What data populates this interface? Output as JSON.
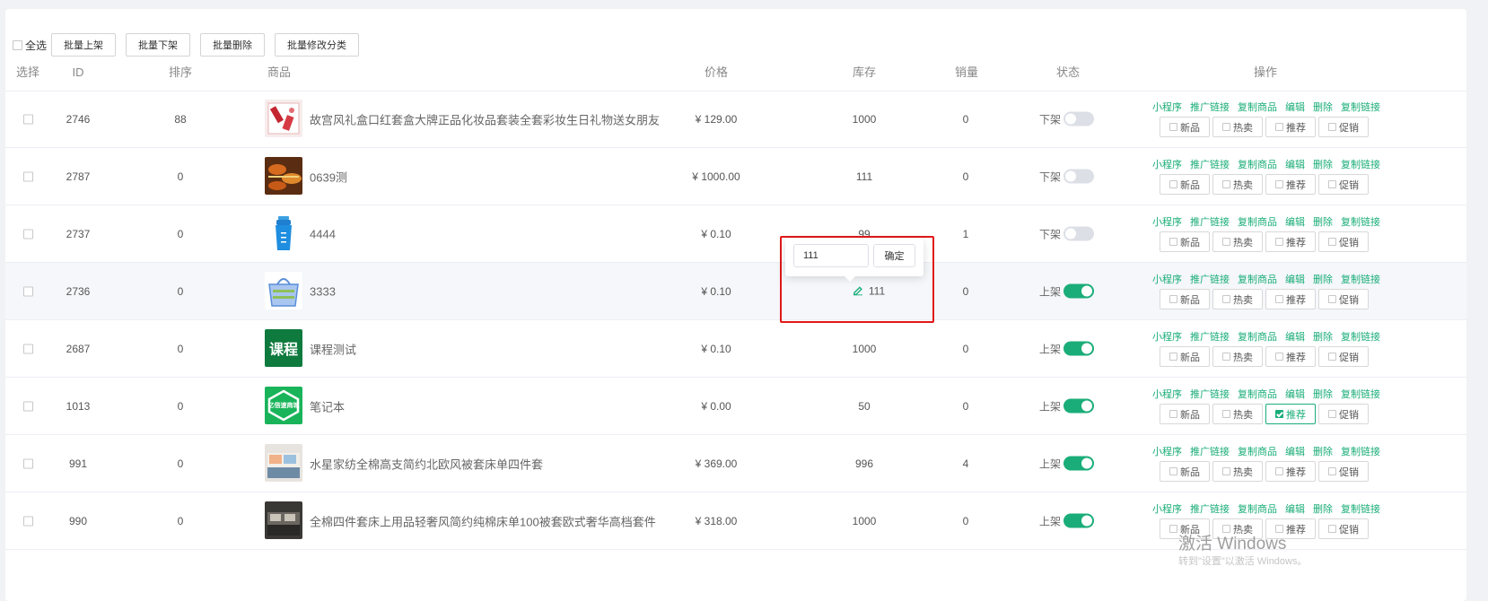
{
  "toolbar": {
    "select_all": "全选",
    "buttons": [
      "批量上架",
      "批量下架",
      "批量删除",
      "批量修改分类"
    ]
  },
  "columns": [
    "选择",
    "ID",
    "排序",
    "商品",
    "价格",
    "库存",
    "销量",
    "状态",
    "操作"
  ],
  "op_links": [
    "小程序",
    "推广链接",
    "复制商品",
    "编辑",
    "删除",
    "复制链接"
  ],
  "tag_labels": [
    "新品",
    "热卖",
    "推荐",
    "促销"
  ],
  "rows": [
    {
      "id": "2746",
      "sort": "88",
      "name": "故宫风礼盒口红套盒大牌正品化妆品套装全套彩妆生日礼物送女朋友",
      "price": "¥ 129.00",
      "stock": "1000",
      "sales": "0",
      "status": "下架",
      "on": false,
      "thumb": "lipstick"
    },
    {
      "id": "2787",
      "sort": "0",
      "name": "0639测",
      "price": "¥ 1000.00",
      "stock": "111",
      "sales": "0",
      "status": "下架",
      "on": false,
      "thumb": "food"
    },
    {
      "id": "2737",
      "sort": "0",
      "name": "4444",
      "price": "¥ 0.10",
      "stock": "99",
      "sales": "1",
      "status": "下架",
      "on": false,
      "thumb": "bottle"
    },
    {
      "id": "2736",
      "sort": "0",
      "name": "3333",
      "price": "¥ 0.10",
      "stock": "111",
      "sales": "0",
      "status": "上架",
      "on": true,
      "thumb": "basket"
    },
    {
      "id": "2687",
      "sort": "0",
      "name": "课程测试",
      "price": "¥ 0.10",
      "stock": "1000",
      "sales": "0",
      "status": "上架",
      "on": true,
      "thumb": "course",
      "thumb_text": "课程"
    },
    {
      "id": "1013",
      "sort": "0",
      "name": "笔记本",
      "price": "¥ 0.00",
      "stock": "50",
      "sales": "0",
      "status": "上架",
      "on": true,
      "thumb": "notebook",
      "thumb_text": "亿倍速商城"
    },
    {
      "id": "991",
      "sort": "0",
      "name": "水星家纺全棉高支简约北欧风被套床单四件套",
      "price": "¥ 369.00",
      "stock": "996",
      "sales": "4",
      "status": "上架",
      "on": true,
      "thumb": "bedding"
    },
    {
      "id": "990",
      "sort": "0",
      "name": "全棉四件套床上用品轻奢风简约纯棉床单100被套欧式奢华高档套件",
      "price": "¥ 318.00",
      "stock": "1000",
      "sales": "0",
      "status": "上架",
      "on": true,
      "thumb": "bedding-dark"
    }
  ],
  "popover": {
    "value": "111",
    "confirm": "确定"
  },
  "watermark": {
    "line1": "激活 Windows",
    "line2": "转到\"设置\"以激活 Windows。"
  },
  "colors": {
    "accent": "#1aad79",
    "highlight_box": "#e01818"
  }
}
